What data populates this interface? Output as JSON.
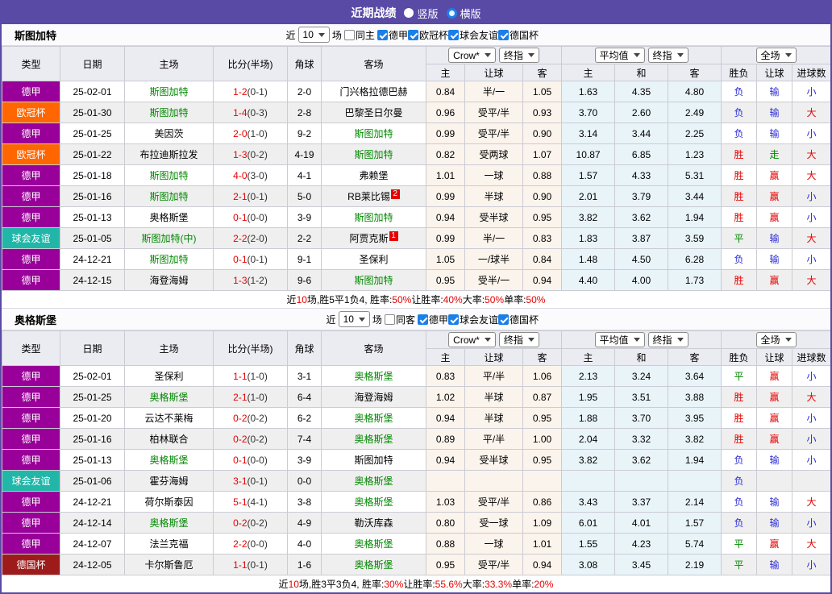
{
  "topbar": {
    "title": "近期战绩",
    "radios": [
      {
        "label": "竖版",
        "checked": false
      },
      {
        "label": "横版",
        "checked": true
      }
    ]
  },
  "labels": {
    "near": "近",
    "matches": "场"
  },
  "dropdowns": {
    "source": "Crow*",
    "source_final": "终指",
    "avg": "平均值",
    "avg_final": "终指",
    "scope": "全场"
  },
  "columns": {
    "type": "类型",
    "date": "日期",
    "home": "主场",
    "score": "比分(半场)",
    "corner": "角球",
    "away": "客场",
    "odds_home": "主",
    "odds_line": "让球",
    "odds_away": "客",
    "avg_home": "主",
    "avg_draw": "和",
    "avg_away": "客",
    "result_wl": "胜负",
    "result_handicap": "让球",
    "result_goals": "进球数"
  },
  "colors": {
    "accent_purple": "#584aa5",
    "type_colors": {
      "德甲": "#990099",
      "欧冠杯": "#ff6600",
      "球会友谊": "#21b6a8",
      "德国杯": "#9e1b1b"
    },
    "result_colors": {
      "胜": "#e60000",
      "平": "#008800",
      "负": "#2b2bd5",
      "赢": "#e60000",
      "走": "#008800",
      "输": "#2b2bd5",
      "大": "#e60000",
      "小": "#2b2bd5"
    },
    "team_highlight_green": "#008800",
    "score_red": "#e60000",
    "crow_bg": "#fbf4ec",
    "avg_bg": "#e9f4f9"
  },
  "sections": [
    {
      "team": "斯图加特",
      "filter": {
        "count": "10",
        "same_label": "同主",
        "same_checked": false,
        "leagues": [
          {
            "label": "德甲",
            "checked": true
          },
          {
            "label": "欧冠杯",
            "checked": true
          },
          {
            "label": "球会友谊",
            "checked": true
          },
          {
            "label": "德国杯",
            "checked": true
          }
        ]
      },
      "rows": [
        {
          "league": "德甲",
          "date": "25-02-01",
          "home": "斯图加特",
          "home_hl": true,
          "ft": "1-2",
          "ht": "(0-1)",
          "corner": "2-0",
          "away": "门兴格拉德巴赫",
          "away_hl": false,
          "away_badge": "",
          "crow": [
            "0.84",
            "半/一",
            "1.05"
          ],
          "avg": [
            "1.63",
            "4.35",
            "4.80"
          ],
          "results": [
            "负",
            "输",
            "小"
          ]
        },
        {
          "league": "欧冠杯",
          "date": "25-01-30",
          "home": "斯图加特",
          "home_hl": true,
          "ft": "1-4",
          "ht": "(0-3)",
          "corner": "2-8",
          "away": "巴黎圣日尔曼",
          "away_hl": false,
          "away_badge": "",
          "crow": [
            "0.96",
            "受平/半",
            "0.93"
          ],
          "avg": [
            "3.70",
            "2.60",
            "2.49"
          ],
          "results": [
            "负",
            "输",
            "大"
          ]
        },
        {
          "league": "德甲",
          "date": "25-01-25",
          "home": "美因茨",
          "home_hl": false,
          "ft": "2-0",
          "ht": "(1-0)",
          "corner": "9-2",
          "away": "斯图加特",
          "away_hl": true,
          "away_badge": "",
          "crow": [
            "0.99",
            "受平/半",
            "0.90"
          ],
          "avg": [
            "3.14",
            "3.44",
            "2.25"
          ],
          "results": [
            "负",
            "输",
            "小"
          ]
        },
        {
          "league": "欧冠杯",
          "date": "25-01-22",
          "home": "布拉迪斯拉发",
          "home_hl": false,
          "ft": "1-3",
          "ht": "(0-2)",
          "corner": "4-19",
          "away": "斯图加特",
          "away_hl": true,
          "away_badge": "",
          "crow": [
            "0.82",
            "受两球",
            "1.07"
          ],
          "avg": [
            "10.87",
            "6.85",
            "1.23"
          ],
          "results": [
            "胜",
            "走",
            "大"
          ]
        },
        {
          "league": "德甲",
          "date": "25-01-18",
          "home": "斯图加特",
          "home_hl": true,
          "ft": "4-0",
          "ht": "(3-0)",
          "corner": "4-1",
          "away": "弗赖堡",
          "away_hl": false,
          "away_badge": "",
          "crow": [
            "1.01",
            "一球",
            "0.88"
          ],
          "avg": [
            "1.57",
            "4.33",
            "5.31"
          ],
          "results": [
            "胜",
            "赢",
            "大"
          ]
        },
        {
          "league": "德甲",
          "date": "25-01-16",
          "home": "斯图加特",
          "home_hl": true,
          "ft": "2-1",
          "ht": "(0-1)",
          "corner": "5-0",
          "away": "RB莱比锡",
          "away_hl": false,
          "away_badge": "2",
          "crow": [
            "0.99",
            "半球",
            "0.90"
          ],
          "avg": [
            "2.01",
            "3.79",
            "3.44"
          ],
          "results": [
            "胜",
            "赢",
            "小"
          ]
        },
        {
          "league": "德甲",
          "date": "25-01-13",
          "home": "奥格斯堡",
          "home_hl": false,
          "ft": "0-1",
          "ht": "(0-0)",
          "corner": "3-9",
          "away": "斯图加特",
          "away_hl": true,
          "away_badge": "",
          "crow": [
            "0.94",
            "受半球",
            "0.95"
          ],
          "avg": [
            "3.82",
            "3.62",
            "1.94"
          ],
          "results": [
            "胜",
            "赢",
            "小"
          ]
        },
        {
          "league": "球会友谊",
          "date": "25-01-05",
          "home": "斯图加特(中)",
          "home_hl": true,
          "ft": "2-2",
          "ht": "(2-0)",
          "corner": "2-2",
          "away": "阿贾克斯",
          "away_hl": false,
          "away_badge": "1",
          "crow": [
            "0.99",
            "半/一",
            "0.83"
          ],
          "avg": [
            "1.83",
            "3.87",
            "3.59"
          ],
          "results": [
            "平",
            "输",
            "大"
          ]
        },
        {
          "league": "德甲",
          "date": "24-12-21",
          "home": "斯图加特",
          "home_hl": true,
          "ft": "0-1",
          "ht": "(0-1)",
          "corner": "9-1",
          "away": "圣保利",
          "away_hl": false,
          "away_badge": "",
          "crow": [
            "1.05",
            "一/球半",
            "0.84"
          ],
          "avg": [
            "1.48",
            "4.50",
            "6.28"
          ],
          "results": [
            "负",
            "输",
            "小"
          ]
        },
        {
          "league": "德甲",
          "date": "24-12-15",
          "home": "海登海姆",
          "home_hl": false,
          "ft": "1-3",
          "ht": "(1-2)",
          "corner": "9-6",
          "away": "斯图加特",
          "away_hl": true,
          "away_badge": "",
          "crow": [
            "0.95",
            "受半/一",
            "0.94"
          ],
          "avg": [
            "4.40",
            "4.00",
            "1.73"
          ],
          "results": [
            "胜",
            "赢",
            "大"
          ]
        }
      ],
      "summary": [
        {
          "t": "近"
        },
        {
          "t": "10",
          "red": true
        },
        {
          "t": "场,胜5平1负4, 胜率:"
        },
        {
          "t": "50%",
          "red": true
        },
        {
          "t": " 让胜率:"
        },
        {
          "t": "40%",
          "red": true
        },
        {
          "t": " 大率:"
        },
        {
          "t": "50%",
          "red": true
        },
        {
          "t": " 单率:"
        },
        {
          "t": "50%",
          "red": true
        }
      ]
    },
    {
      "team": "奥格斯堡",
      "filter": {
        "count": "10",
        "same_label": "同客",
        "same_checked": false,
        "leagues": [
          {
            "label": "德甲",
            "checked": true
          },
          {
            "label": "球会友谊",
            "checked": true
          },
          {
            "label": "德国杯",
            "checked": true
          }
        ]
      },
      "rows": [
        {
          "league": "德甲",
          "date": "25-02-01",
          "home": "圣保利",
          "home_hl": false,
          "ft": "1-1",
          "ht": "(1-0)",
          "corner": "3-1",
          "away": "奥格斯堡",
          "away_hl": true,
          "away_badge": "",
          "crow": [
            "0.83",
            "平/半",
            "1.06"
          ],
          "avg": [
            "2.13",
            "3.24",
            "3.64"
          ],
          "results": [
            "平",
            "赢",
            "小"
          ]
        },
        {
          "league": "德甲",
          "date": "25-01-25",
          "home": "奥格斯堡",
          "home_hl": true,
          "ft": "2-1",
          "ht": "(1-0)",
          "corner": "6-4",
          "away": "海登海姆",
          "away_hl": false,
          "away_badge": "",
          "crow": [
            "1.02",
            "半球",
            "0.87"
          ],
          "avg": [
            "1.95",
            "3.51",
            "3.88"
          ],
          "results": [
            "胜",
            "赢",
            "大"
          ]
        },
        {
          "league": "德甲",
          "date": "25-01-20",
          "home": "云达不莱梅",
          "home_hl": false,
          "ft": "0-2",
          "ht": "(0-2)",
          "corner": "6-2",
          "away": "奥格斯堡",
          "away_hl": true,
          "away_badge": "",
          "crow": [
            "0.94",
            "半球",
            "0.95"
          ],
          "avg": [
            "1.88",
            "3.70",
            "3.95"
          ],
          "results": [
            "胜",
            "赢",
            "小"
          ]
        },
        {
          "league": "德甲",
          "date": "25-01-16",
          "home": "柏林联合",
          "home_hl": false,
          "ft": "0-2",
          "ht": "(0-2)",
          "corner": "7-4",
          "away": "奥格斯堡",
          "away_hl": true,
          "away_badge": "",
          "crow": [
            "0.89",
            "平/半",
            "1.00"
          ],
          "avg": [
            "2.04",
            "3.32",
            "3.82"
          ],
          "results": [
            "胜",
            "赢",
            "小"
          ]
        },
        {
          "league": "德甲",
          "date": "25-01-13",
          "home": "奥格斯堡",
          "home_hl": true,
          "ft": "0-1",
          "ht": "(0-0)",
          "corner": "3-9",
          "away": "斯图加特",
          "away_hl": false,
          "away_badge": "",
          "crow": [
            "0.94",
            "受半球",
            "0.95"
          ],
          "avg": [
            "3.82",
            "3.62",
            "1.94"
          ],
          "results": [
            "负",
            "输",
            "小"
          ]
        },
        {
          "league": "球会友谊",
          "date": "25-01-06",
          "home": "霍芬海姆",
          "home_hl": false,
          "ft": "3-1",
          "ht": "(0-1)",
          "corner": "0-0",
          "away": "奥格斯堡",
          "away_hl": true,
          "away_badge": "",
          "crow": [
            "",
            "",
            ""
          ],
          "avg": [
            "",
            "",
            ""
          ],
          "results": [
            "负",
            "",
            ""
          ]
        },
        {
          "league": "德甲",
          "date": "24-12-21",
          "home": "荷尔斯泰因",
          "home_hl": false,
          "ft": "5-1",
          "ht": "(4-1)",
          "corner": "3-8",
          "away": "奥格斯堡",
          "away_hl": true,
          "away_badge": "",
          "crow": [
            "1.03",
            "受平/半",
            "0.86"
          ],
          "avg": [
            "3.43",
            "3.37",
            "2.14"
          ],
          "results": [
            "负",
            "输",
            "大"
          ]
        },
        {
          "league": "德甲",
          "date": "24-12-14",
          "home": "奥格斯堡",
          "home_hl": true,
          "ft": "0-2",
          "ht": "(0-2)",
          "corner": "4-9",
          "away": "勒沃库森",
          "away_hl": false,
          "away_badge": "",
          "crow": [
            "0.80",
            "受一球",
            "1.09"
          ],
          "avg": [
            "6.01",
            "4.01",
            "1.57"
          ],
          "results": [
            "负",
            "输",
            "小"
          ]
        },
        {
          "league": "德甲",
          "date": "24-12-07",
          "home": "法兰克福",
          "home_hl": false,
          "ft": "2-2",
          "ht": "(0-0)",
          "corner": "4-0",
          "away": "奥格斯堡",
          "away_hl": true,
          "away_badge": "",
          "crow": [
            "0.88",
            "一球",
            "1.01"
          ],
          "avg": [
            "1.55",
            "4.23",
            "5.74"
          ],
          "results": [
            "平",
            "赢",
            "大"
          ]
        },
        {
          "league": "德国杯",
          "date": "24-12-05",
          "home": "卡尔斯鲁厄",
          "home_hl": false,
          "ft": "1-1",
          "ht": "(0-1)",
          "corner": "1-6",
          "away": "奥格斯堡",
          "away_hl": true,
          "away_badge": "",
          "crow": [
            "0.95",
            "受平/半",
            "0.94"
          ],
          "avg": [
            "3.08",
            "3.45",
            "2.19"
          ],
          "results": [
            "平",
            "输",
            "小"
          ]
        }
      ],
      "summary": [
        {
          "t": "近"
        },
        {
          "t": "10",
          "red": true
        },
        {
          "t": "场,胜3平3负4, 胜率:"
        },
        {
          "t": "30%",
          "red": true
        },
        {
          "t": " 让胜率:"
        },
        {
          "t": "55.6%",
          "red": true
        },
        {
          "t": " 大率:"
        },
        {
          "t": "33.3%",
          "red": true
        },
        {
          "t": " 单率:"
        },
        {
          "t": "20%",
          "red": true
        }
      ]
    }
  ]
}
